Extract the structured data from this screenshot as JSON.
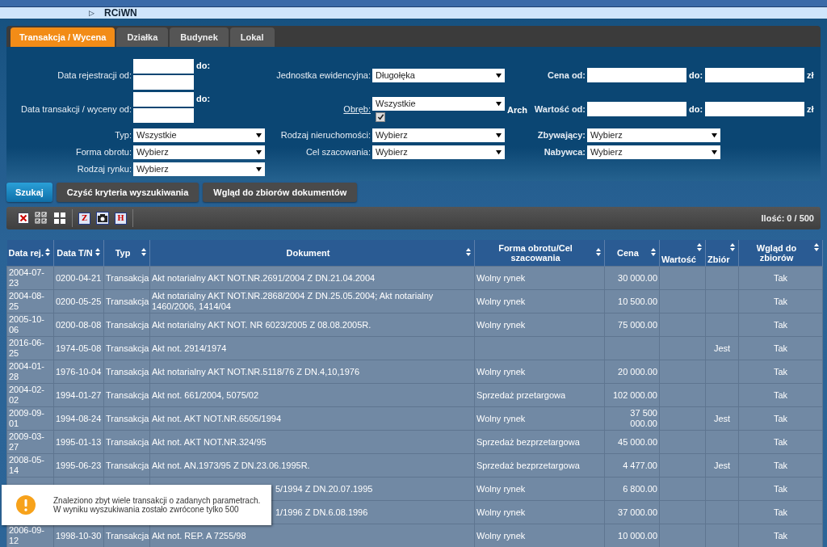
{
  "breadcrumb": {
    "arrow": "▷",
    "title": "RCiWN"
  },
  "tabs": [
    {
      "label": "Transakcja / Wycena",
      "selected": true
    },
    {
      "label": "Działka",
      "selected": false
    },
    {
      "label": "Budynek",
      "selected": false
    },
    {
      "label": "Lokal",
      "selected": false
    }
  ],
  "filters": [
    [
      {
        "kind": "date_range",
        "label": "Data rejestracji od:",
        "to_label": "do:"
      },
      {
        "kind": "date_range",
        "label": "Data transakcji / wyceny od:",
        "to_label": "do:"
      },
      {
        "kind": "select",
        "label": "Typ:",
        "value": "Wszystkie"
      },
      {
        "kind": "select",
        "label": "Forma obrotu:",
        "value": "Wybierz"
      },
      {
        "kind": "select",
        "label": "Rodzaj rynku:",
        "value": "Wybierz"
      }
    ],
    [
      {
        "kind": "select",
        "label": "Jednostka ewidencyjna:",
        "value": "Długołęka"
      },
      {
        "kind": "select_check",
        "label": "Obręb:",
        "value": "Wszystkie",
        "suffix": "Arch",
        "checked": true
      },
      {
        "kind": "select",
        "label": "Rodzaj nieruchomości:",
        "value": "Wybierz"
      },
      {
        "kind": "select",
        "label": "Cel szacowania:",
        "value": "Wybierz"
      }
    ],
    [
      {
        "kind": "range",
        "label": "Cena od:",
        "to_label": "do:",
        "unit": "zł"
      },
      {
        "kind": "range",
        "label": "Wartość od:",
        "to_label": "do:",
        "unit": "zł"
      },
      {
        "kind": "select",
        "label": "Zbywający:",
        "value": "Wybierz"
      },
      {
        "kind": "select",
        "label": "Nabywca:",
        "value": "Wybierz"
      }
    ]
  ],
  "actions": [
    {
      "label": "Szukaj",
      "primary": true
    },
    {
      "label": "Czyść kryteria wyszukiwania",
      "primary": false
    },
    {
      "label": "Wgląd do zbiorów dokumentów",
      "primary": false
    }
  ],
  "toolbar": [
    {
      "kind": "x"
    },
    {
      "kind": "checklist"
    },
    {
      "kind": "grid"
    },
    {
      "kind": "letter",
      "glyph": "Z"
    },
    {
      "kind": "camera"
    },
    {
      "kind": "letter",
      "glyph": "H"
    }
  ],
  "count": "Ilość: 0 / 500",
  "table": {
    "columns": [
      "Data rej.",
      "Data T/N",
      "Typ",
      "Dokument",
      "Forma obrotu/Cel szacowania",
      "Cena",
      "Wartość",
      "Zbiór",
      "Wgląd do zbiorów"
    ],
    "rows": [
      {
        "covered": false,
        "cells": [
          "2004-07-23",
          "0200-04-21",
          "Transakcja",
          "Akt notarialny AKT NOT.NR.2691/2004 Z DN.21.04.2004",
          "Wolny rynek",
          "30 000.00",
          "",
          "",
          "Tak"
        ]
      },
      {
        "covered": false,
        "cells": [
          "2004-08-25",
          "0200-05-25",
          "Transakcja",
          "Akt notarialny AKT NOT.NR.2868/2004 Z DN.25.05.2004; Akt notarialny 1460/2006, 1414/04",
          "Wolny rynek",
          "10 500.00",
          "",
          "",
          "Tak"
        ]
      },
      {
        "covered": false,
        "cells": [
          "2005-10-06",
          "0200-08-08",
          "Transakcja",
          "Akt notarialny AKT NOT. NR 6023/2005 Z 08.08.2005R.",
          "Wolny rynek",
          "75 000.00",
          "",
          "",
          "Tak"
        ]
      },
      {
        "covered": false,
        "cells": [
          "2016-06-25",
          "1974-05-08",
          "Transakcja",
          "Akt not. 2914/1974",
          "",
          "",
          "",
          "Jest",
          "Tak"
        ]
      },
      {
        "covered": false,
        "cells": [
          "2004-01-28",
          "1976-10-04",
          "Transakcja",
          "Akt notarialny AKT NOT.NR.5118/76 Z DN.4,10,1976",
          "Wolny rynek",
          "20 000.00",
          "",
          "",
          "Tak"
        ]
      },
      {
        "covered": false,
        "cells": [
          "2004-02-02",
          "1994-01-27",
          "Transakcja",
          "Akt not. 661/2004, 5075/02",
          "Sprzedaż przetargowa",
          "102 000.00",
          "",
          "",
          "Tak"
        ]
      },
      {
        "covered": false,
        "cells": [
          "2009-09-01",
          "1994-08-24",
          "Transakcja",
          "Akt not. AKT NOT.NR.6505/1994",
          "Wolny rynek",
          "37 500 000.00",
          "",
          "Jest",
          "Tak"
        ]
      },
      {
        "covered": false,
        "cells": [
          "2009-03-27",
          "1995-01-13",
          "Transakcja",
          "Akt not. AKT NOT.NR.324/95",
          "Sprzedaż bezprzetargowa",
          "45 000.00",
          "",
          "",
          "Tak"
        ]
      },
      {
        "covered": false,
        "cells": [
          "2008-05-14",
          "1995-06-23",
          "Transakcja",
          "Akt not. AN.1973/95 Z DN.23.06.1995R.",
          "Sprzedaż bezprzetargowa",
          "4 477.00",
          "",
          "Jest",
          "Tak"
        ]
      },
      {
        "covered": true,
        "cells": [
          "",
          "",
          "",
          "5/1994 Z DN.20.07.1995",
          "Wolny rynek",
          "6 800.00",
          "",
          "",
          "Tak"
        ]
      },
      {
        "covered": true,
        "cells": [
          "",
          "",
          "",
          "1/1996 Z DN.6.08.1996",
          "Wolny rynek",
          "37 000.00",
          "",
          "",
          "Tak"
        ]
      },
      {
        "covered": false,
        "cells": [
          "2006-09-12",
          "1998-10-30",
          "Transakcja",
          "Akt not. REP. A 7255/98",
          "Wolny rynek",
          "10 000.00",
          "",
          "",
          "Tak"
        ]
      }
    ]
  },
  "toast": {
    "message": "Znaleziono zbyt wiele transakcji o zadanych parametrach. W wyniku wyszukiwania zostało zwrócone tylko 500"
  }
}
